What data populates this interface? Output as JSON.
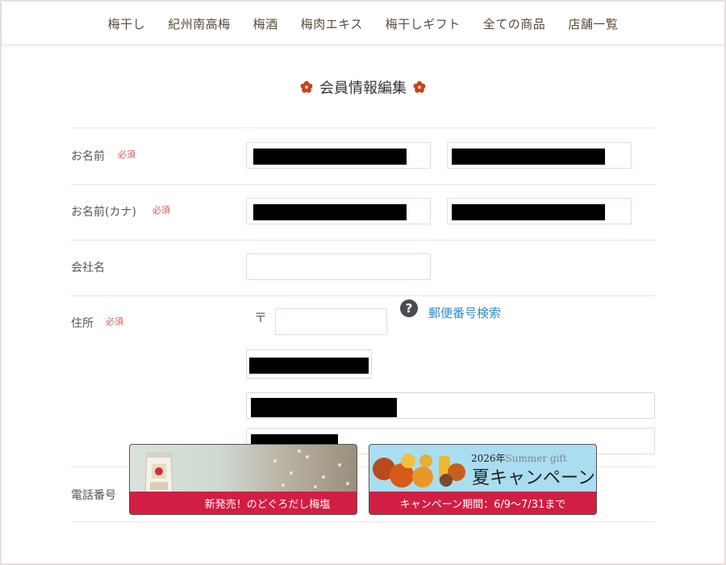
{
  "nav": {
    "items": [
      "梅干し",
      "紀州南高梅",
      "梅酒",
      "梅肉エキス",
      "梅干しギフト",
      "全ての商品",
      "店舗一覧"
    ]
  },
  "page": {
    "title": "会員情報編集"
  },
  "form": {
    "name": {
      "label": "お名前",
      "required": "必須"
    },
    "kana": {
      "label": "お名前(カナ)",
      "required": "必須"
    },
    "company": {
      "label": "会社名"
    },
    "address": {
      "label": "住所",
      "required": "必須",
      "zip_mark": "〒",
      "help": "?",
      "zip_search": "郵便番号検索"
    },
    "phone": {
      "label": "電話番号"
    }
  },
  "banners": {
    "left": {
      "caption": "新発売！のどぐろだし梅塩"
    },
    "right": {
      "year": "2026年",
      "subtitle": "Summer gift",
      "headline": "夏キャンペーン",
      "caption": "キャンペーン期間：6/9〜7/31まで"
    }
  },
  "colors": {
    "accent_red": "#d11e43",
    "required": "#d25a5a",
    "link": "#2f8ec7",
    "flower": "#c8421a"
  }
}
